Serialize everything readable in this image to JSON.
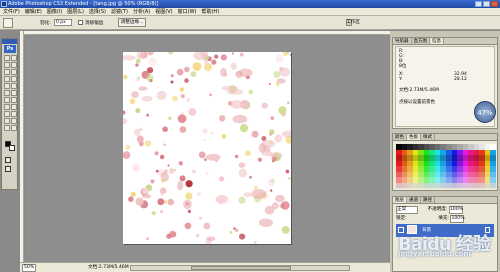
{
  "window": {
    "title": "Adobe Photoshop CS3 Extended - [tang.jpg @ 50% (RGB/8)]"
  },
  "menu": [
    "文件(F)",
    "编辑(E)",
    "图像(I)",
    "图层(L)",
    "选择(S)",
    "滤镜(T)",
    "分析(A)",
    "视图(V)",
    "窗口(W)",
    "帮助(H)"
  ],
  "options": {
    "feather_label": "羽化:",
    "feather_value": "0 px",
    "antialias_label": "消除锯齿",
    "style_label": "样式:",
    "style_value": "正常",
    "refine_label": "调整边缘...",
    "workspace_label": "工作区"
  },
  "status": {
    "zoom": "50%",
    "doc_size": "文档:2.73M/5.46M"
  },
  "panels": {
    "nav_tabs": [
      "导航器",
      "直方图",
      "信息"
    ],
    "info": {
      "r_label": "R:",
      "g_label": "G:",
      "b_label": "B:",
      "bit_label": "8位",
      "x_label": "X:",
      "y_label": "Y:",
      "x_value": "32.94",
      "y_value": "28.12",
      "w_label": "W:",
      "h_label": "H:",
      "doc_size": "文档:2.73M/5.46M",
      "hint": "点按以设置前景色"
    },
    "perf_percent": "47%",
    "color_tabs": [
      "颜色",
      "色板",
      "样式"
    ],
    "layer_tabs": [
      "图层",
      "通道",
      "路径"
    ],
    "layers": {
      "blend_mode": "正常",
      "opacity_label": "不透明度:",
      "opacity_value": "100%",
      "lock_label": "锁定:",
      "fill_label": "填充:",
      "fill_value": "100%",
      "layer_name": "背景"
    }
  },
  "watermark": {
    "text": "Baidu 经验",
    "sub": "jingyan.baidu.com"
  },
  "colors": {
    "titlebar": "#2f5cb3",
    "canvas_bg": "#8e8e8e",
    "selected_layer": "#3f6cc9"
  }
}
